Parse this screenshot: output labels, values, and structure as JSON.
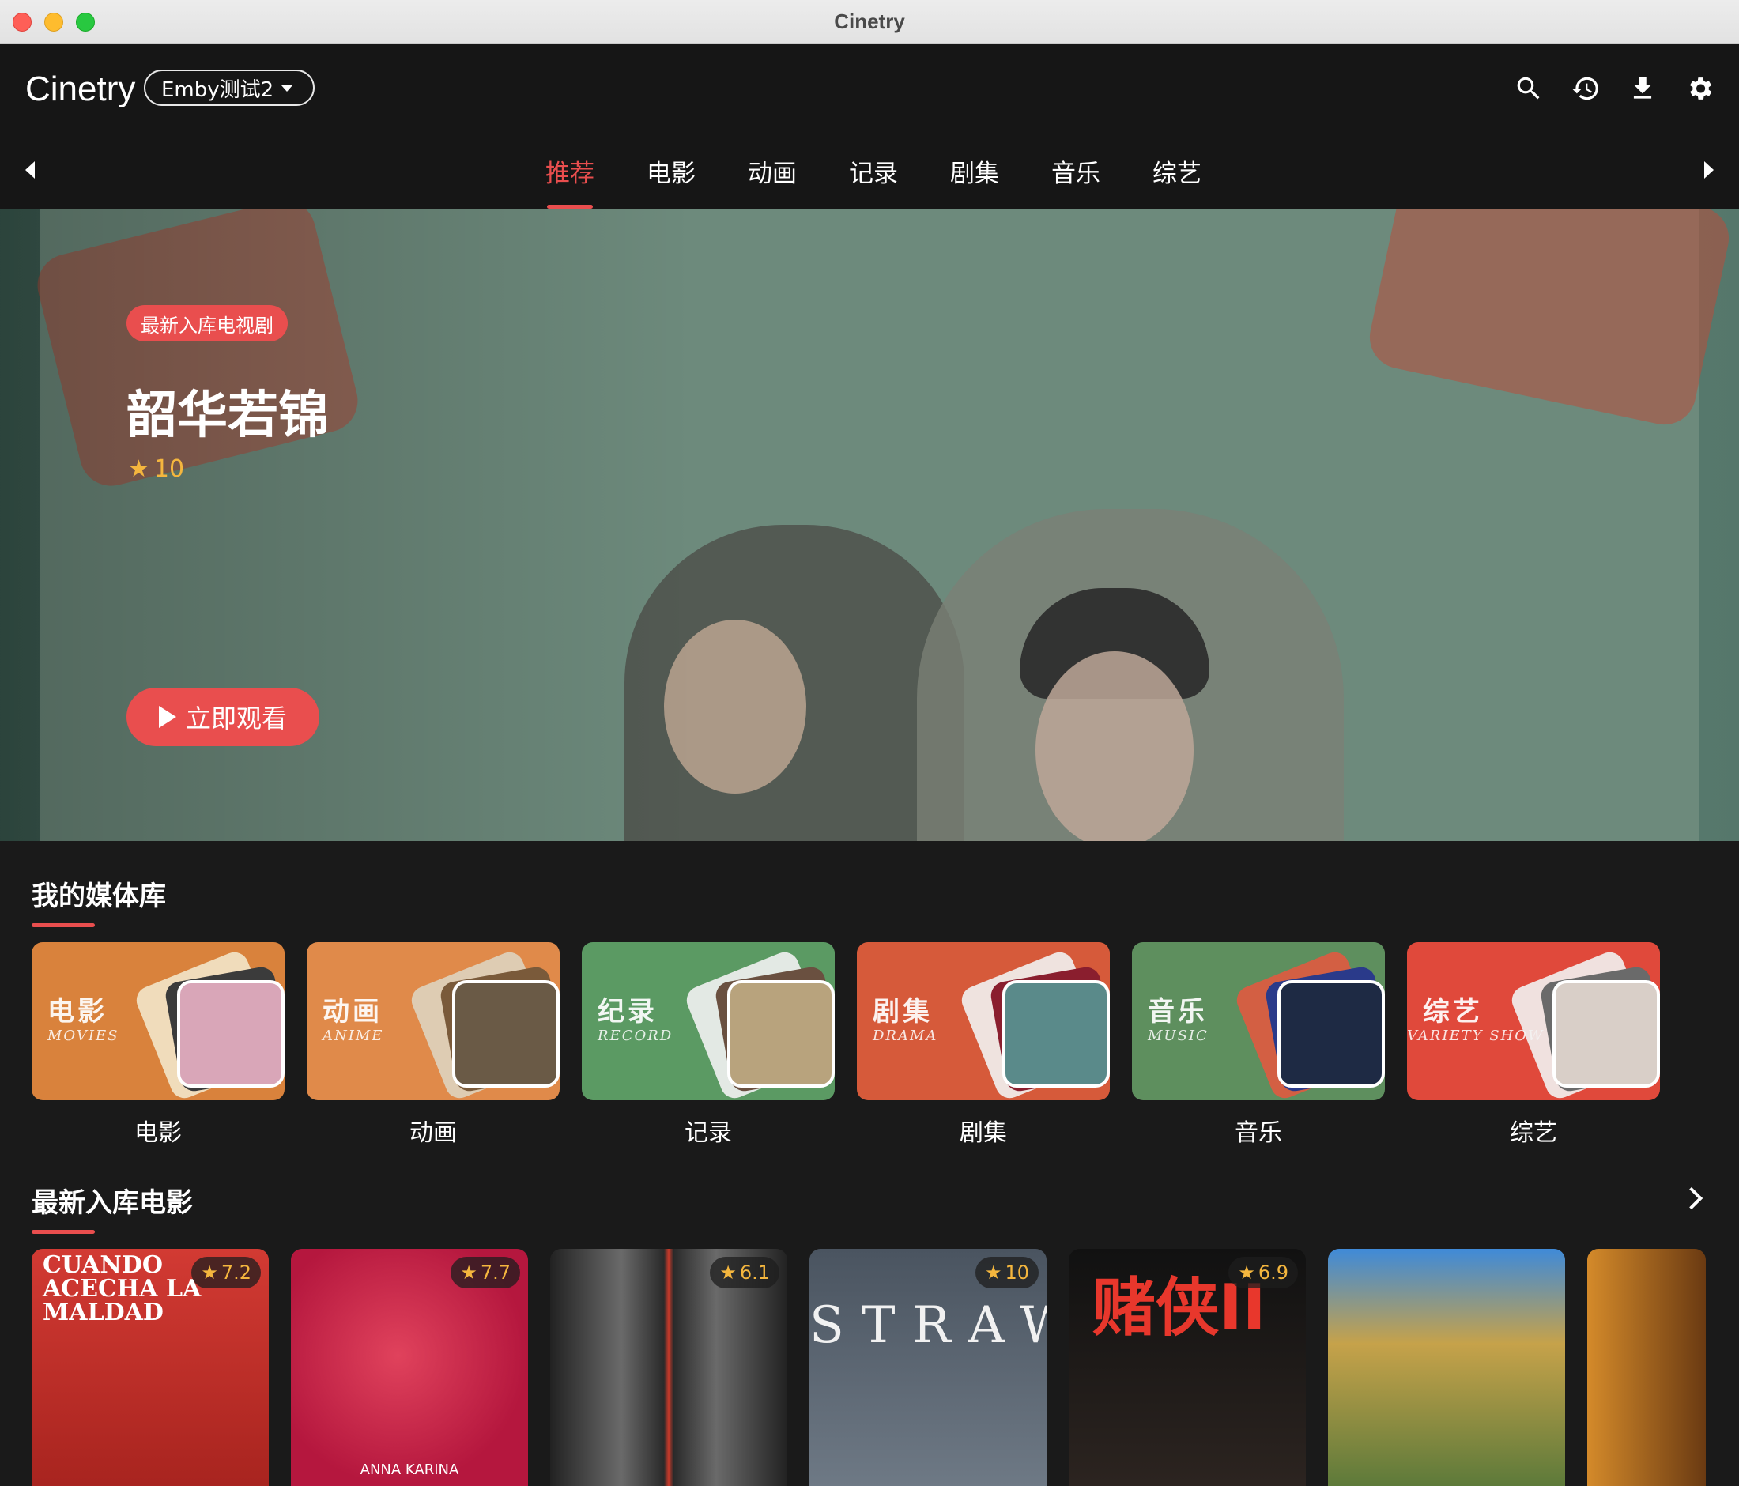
{
  "window": {
    "title": "Cinetry"
  },
  "app": {
    "logo": "Cinetry",
    "server": "Emby测试2"
  },
  "toolbar_icons": [
    "search-icon",
    "history-icon",
    "download-icon",
    "settings-icon"
  ],
  "tabs": [
    {
      "label": "推荐",
      "active": true
    },
    {
      "label": "电影"
    },
    {
      "label": "动画"
    },
    {
      "label": "记录"
    },
    {
      "label": "剧集"
    },
    {
      "label": "音乐"
    },
    {
      "label": "综艺"
    }
  ],
  "hero": {
    "badge": "最新入库电视剧",
    "title": "韶华若锦",
    "rating": "10",
    "play_label": "立即观看"
  },
  "library": {
    "title": "我的媒体库",
    "items": [
      {
        "label": "电影",
        "card_cn": "电影",
        "card_en": "MOVIES",
        "color": "#d9823c"
      },
      {
        "label": "动画",
        "card_cn": "动画",
        "card_en": "ANIME",
        "color": "#e08a4a"
      },
      {
        "label": "记录",
        "card_cn": "纪录",
        "card_en": "RECORD",
        "color": "#5b9a63"
      },
      {
        "label": "剧集",
        "card_cn": "剧集",
        "card_en": "DRAMA",
        "color": "#d65a3a"
      },
      {
        "label": "音乐",
        "card_cn": "音乐",
        "card_en": "MUSIC",
        "color": "#5e8f5e"
      },
      {
        "label": "综艺",
        "card_cn": "综艺",
        "card_en": "VARIETY SHOW",
        "color": "#e0493b"
      }
    ]
  },
  "latest_movies": {
    "title": "最新入库电影",
    "items": [
      {
        "rating": "7.2",
        "poster_text": "CUANDO ACECHA LA MALDAD",
        "color": "#c8352f"
      },
      {
        "rating": "7.7",
        "poster_text": "ANNA KARINA",
        "color": "#c81d4f"
      },
      {
        "rating": "6.1",
        "poster_text": "",
        "color": "#3a3a3a"
      },
      {
        "rating": "10",
        "poster_text": "STRAW",
        "color": "#5a6570"
      },
      {
        "rating": "6.9",
        "poster_text": "赌侠II",
        "color": "#151515"
      },
      {
        "rating": "",
        "poster_text": "",
        "color": "#3f7fd0"
      },
      {
        "rating": "",
        "poster_text": "",
        "color": "#8a4a1a"
      }
    ]
  }
}
